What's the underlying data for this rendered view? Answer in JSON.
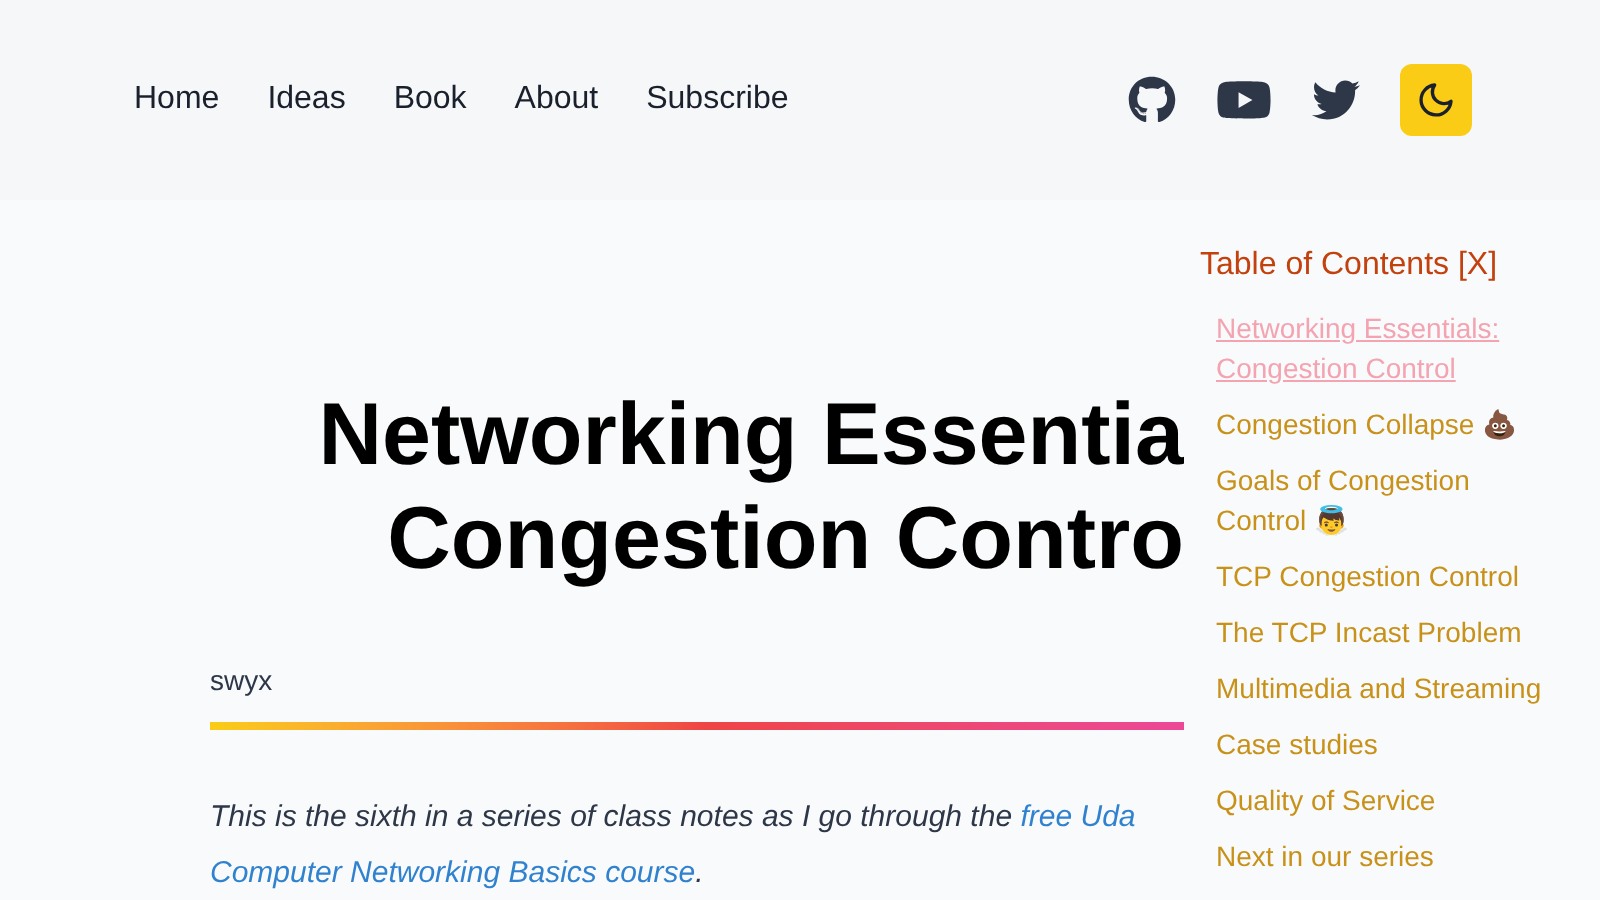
{
  "nav": {
    "links": [
      "Home",
      "Ideas",
      "Book",
      "About",
      "Subscribe"
    ],
    "icons": [
      {
        "kind": "github"
      },
      {
        "kind": "youtube"
      },
      {
        "kind": "twitter"
      }
    ],
    "theme_toggle": {
      "on": true
    }
  },
  "article": {
    "title_lines": [
      "Networking Essentia",
      "Congestion Contro"
    ],
    "author": "swyx",
    "intro_lines": [
      [
        {
          "kind": "text",
          "text": "This is the sixth in a series of class notes as I go through the "
        },
        {
          "kind": "link",
          "text": "free Uda"
        }
      ],
      [
        {
          "kind": "link",
          "text": "Computer Networking Basics course"
        },
        {
          "kind": "text",
          "text": "."
        }
      ]
    ]
  },
  "toc": {
    "title": "Table of Contents [X]",
    "items": [
      {
        "label": "Networking Essentials: Congestion Control",
        "selected": true
      },
      {
        "label": "Congestion Collapse 💩",
        "selected": false
      },
      {
        "label": "Goals of Congestion Control 👼",
        "selected": false
      },
      {
        "label": "TCP Congestion Control",
        "selected": false
      },
      {
        "label": "The TCP Incast Problem",
        "selected": false
      },
      {
        "label": "Multimedia and Streaming",
        "selected": false
      },
      {
        "label": "Case studies",
        "selected": false
      },
      {
        "label": "Quality of Service",
        "selected": false
      },
      {
        "label": "Next in our series",
        "selected": false
      }
    ]
  }
}
